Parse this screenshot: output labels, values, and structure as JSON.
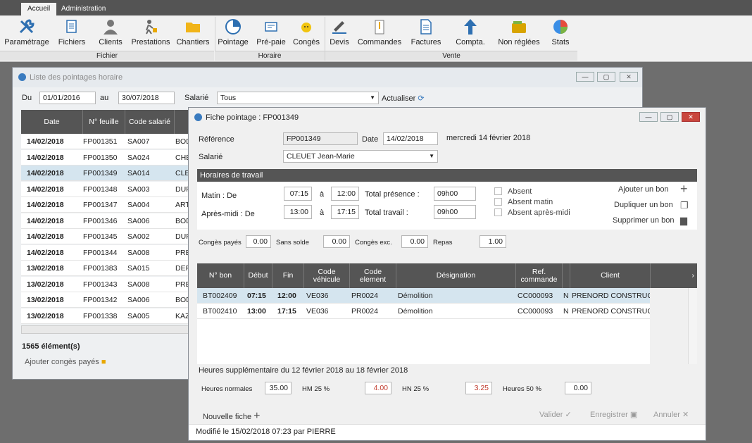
{
  "tabs": [
    "Accueil",
    "Administration"
  ],
  "ribbon": {
    "buttons": [
      {
        "label": "Paramétrage",
        "icon": "wrench-icon"
      },
      {
        "label": "Fichiers",
        "icon": "files-icon"
      },
      {
        "label": "Clients",
        "icon": "user-icon"
      },
      {
        "label": "Prestations",
        "icon": "worker-icon"
      },
      {
        "label": "Chantiers",
        "icon": "folder-icon"
      },
      {
        "label": "Pointage",
        "icon": "clock-icon"
      },
      {
        "label": "Pré-paie",
        "icon": "payslip-icon"
      },
      {
        "label": "Congès",
        "icon": "smiley-icon"
      },
      {
        "label": "Devis",
        "icon": "pen-icon"
      },
      {
        "label": "Commandes",
        "icon": "clipboard-icon"
      },
      {
        "label": "Factures",
        "icon": "invoice-icon"
      },
      {
        "label": "Compta.",
        "icon": "upload-arrow-icon"
      },
      {
        "label": "Non réglées",
        "icon": "wallet-icon"
      },
      {
        "label": "Stats",
        "icon": "pie-chart-icon"
      }
    ],
    "groups": [
      "Fichier",
      "Horaire",
      "Vente"
    ]
  },
  "list": {
    "title": "Liste des pointages horaire",
    "du_label": "Du",
    "du": "01/01/2016",
    "au_label": "au",
    "au": "30/07/2018",
    "salarie_label": "Salarié",
    "salarie": "Tous",
    "refresh": "Actualiser",
    "columns": [
      "Date",
      "N° feuille",
      "Code salarié"
    ],
    "rows": [
      [
        "14/02/2018",
        "FP001351",
        "SA007",
        "BOD"
      ],
      [
        "14/02/2018",
        "FP001350",
        "SA024",
        "CHE"
      ],
      [
        "14/02/2018",
        "FP001349",
        "SA014",
        "CLE"
      ],
      [
        "14/02/2018",
        "FP001348",
        "SA003",
        "DUF"
      ],
      [
        "14/02/2018",
        "FP001347",
        "SA004",
        "ART"
      ],
      [
        "14/02/2018",
        "FP001346",
        "SA006",
        "BOD"
      ],
      [
        "14/02/2018",
        "FP001345",
        "SA002",
        "DUF"
      ],
      [
        "14/02/2018",
        "FP001344",
        "SA008",
        "PRE"
      ],
      [
        "13/02/2018",
        "FP001383",
        "SA015",
        "DEF"
      ],
      [
        "13/02/2018",
        "FP001343",
        "SA008",
        "PRE"
      ],
      [
        "13/02/2018",
        "FP001342",
        "SA006",
        "BOD"
      ],
      [
        "13/02/2018",
        "FP001338",
        "SA005",
        "KAZ"
      ]
    ],
    "count": "1565 élément(s)",
    "add_leave": "Ajouter congès payés"
  },
  "fiche": {
    "title": "Fiche pointage : FP001349",
    "ref_label": "Référence",
    "ref": "FP001349",
    "date_label": "Date",
    "date": "14/02/2018",
    "date_long": "mercredi 14 février 2018",
    "salarie_label": "Salarié",
    "salarie": "CLEUET Jean-Marie",
    "section": "Horaires de travail",
    "matin_label": "Matin : De",
    "matin_de": "07:15",
    "matin_a": "12:00",
    "a_label": "à",
    "aprem_label": "Après-midi : De",
    "aprem_de": "13:00",
    "aprem_a": "17:15",
    "tot_pres_label": "Total présence :",
    "tot_pres": "09h00",
    "tot_trav_label": "Total travail :",
    "tot_trav": "09h00",
    "absent": "Absent",
    "absent_matin": "Absent matin",
    "absent_aprem": "Absent après-midi",
    "add_bon": "Ajouter un bon",
    "dup_bon": "Dupliquer un bon",
    "del_bon": "Supprimer un bon",
    "conges_payes_label": "Congès payés",
    "conges_payes": "0.00",
    "sans_solde_label": "Sans solde",
    "sans_solde": "0.00",
    "conges_exc_label": "Congès exc.",
    "conges_exc": "0.00",
    "repas_label": "Repas",
    "repas": "1.00",
    "columns": [
      "N° bon",
      "Début",
      "Fin",
      "Code véhicule",
      "Code element",
      "Désignation",
      "Ref. commande",
      "",
      "Client"
    ],
    "rows": [
      [
        "BT002409",
        "07:15",
        "12:00",
        "VE036",
        "PR0024",
        "Démolition",
        "CC000093",
        "N",
        "PRENORD CONSTRUC"
      ],
      [
        "BT002410",
        "13:00",
        "17:15",
        "VE036",
        "PR0024",
        "Démolition",
        "CC000093",
        "N",
        "PRENORD CONSTRUC"
      ]
    ],
    "hs_title": "Heures supplémentaire du 12 février 2018 au 18 février 2018",
    "h_norm_label": "Heures normales",
    "h_norm": "35.00",
    "hm25_label": "HM 25 %",
    "hm25": "4.00",
    "hn25_label": "HN 25 %",
    "hn25": "3.25",
    "h50_label": "Heures 50 %",
    "h50": "0.00",
    "nouvelle": "Nouvelle fiche",
    "valider": "Valider",
    "enregistrer": "Enregistrer",
    "annuler": "Annuler",
    "footer": "Modifié le 15/02/2018 07:23 par PIERRE"
  }
}
